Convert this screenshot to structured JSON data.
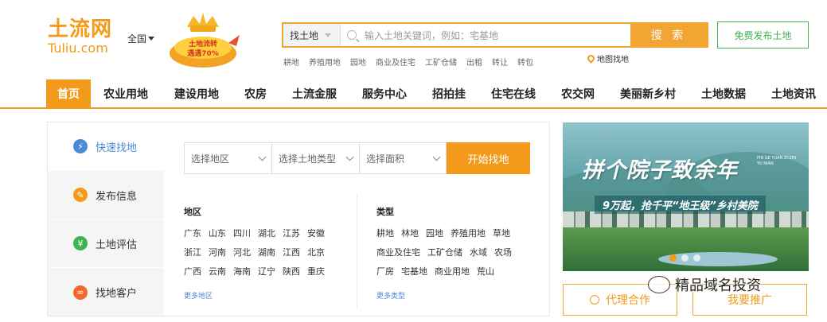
{
  "header": {
    "logo_cn": "土流网",
    "logo_en": "Tuliu.com",
    "city": "全国",
    "promo_badge": "土地流转\n遇遇70%",
    "search_type": "找土地",
    "search_placeholder": "输入土地关键词，例如：宅基地",
    "search_button": "搜 索",
    "quick_links": [
      "耕地",
      "养殖用地",
      "园地",
      "商业及住宅",
      "工矿仓储",
      "出租",
      "转让",
      "转包"
    ],
    "map_find": "地图找地",
    "free_publish": "免费发布土地"
  },
  "nav": {
    "items": [
      "首页",
      "农业用地",
      "建设用地",
      "农房",
      "土流金服",
      "服务中心",
      "招拍挂",
      "住宅在线",
      "农交网",
      "美丽新乡村",
      "土地数据",
      "土地资讯"
    ]
  },
  "side_nav": {
    "items": [
      {
        "label": "快速找地",
        "icon": "lightning-icon",
        "color": "#4a8ad9"
      },
      {
        "label": "发布信息",
        "icon": "pencil-icon",
        "color": "#f39a1b"
      },
      {
        "label": "土地评估",
        "icon": "yen-icon",
        "color": "#3fb34f"
      },
      {
        "label": "找地客户",
        "icon": "handshake-icon",
        "color": "#f06a2a"
      }
    ]
  },
  "filters": {
    "region": "选择地区",
    "land_type": "选择土地类型",
    "area": "选择面积",
    "start": "开始找地"
  },
  "regions": {
    "title": "地区",
    "items": [
      "广东",
      "山东",
      "四川",
      "湖北",
      "江苏",
      "安徽",
      "浙江",
      "河南",
      "河北",
      "湖南",
      "江西",
      "北京",
      "广西",
      "云南",
      "海南",
      "辽宁",
      "陕西",
      "重庆"
    ],
    "more": "更多地区"
  },
  "types": {
    "title": "类型",
    "items": [
      "耕地",
      "林地",
      "园地",
      "养殖用地",
      "草地",
      "商业及住宅",
      "工矿仓储",
      "水域",
      "农场",
      "厂房",
      "宅基地",
      "商业用地",
      "荒山"
    ],
    "more": "更多类型"
  },
  "banner": {
    "title": "拼个院子致余年",
    "pinyin": "PIN GE YUAN ZI ZHI YU NIAN",
    "subtitle": "9万起，抢千平“地王级”乡村美院",
    "slide_active": 1,
    "slide_count": 3
  },
  "buttons": {
    "agent": "代理合作",
    "promote": "我要推广"
  },
  "watermark": "精品域名投资",
  "colors": {
    "brand_orange": "#f39a1b",
    "green": "#3fb34f",
    "blue": "#4a8ad9"
  }
}
